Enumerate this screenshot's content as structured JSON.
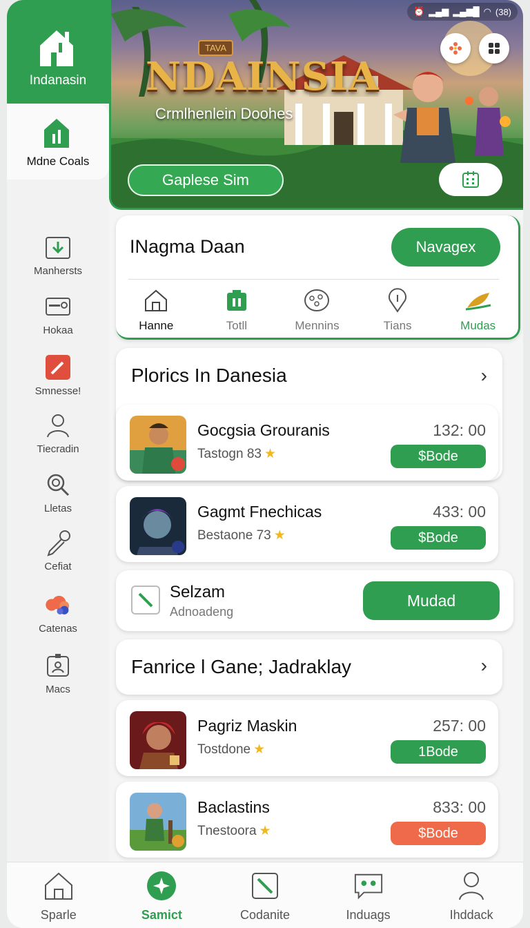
{
  "status": {
    "icons": [
      "alarm-icon",
      "signal-icon",
      "signal-icon",
      "wifi-icon",
      "battery-icon"
    ],
    "battery": "(38)"
  },
  "sidebar": {
    "top": {
      "label": "Indanasin",
      "icon": "home-icon"
    },
    "selected": {
      "label": "Mdne Coals",
      "icon": "home-icon"
    },
    "items": [
      {
        "label": "Manhersts",
        "icon": "download-icon"
      },
      {
        "label": "Hokaa",
        "icon": "card-icon"
      },
      {
        "label": "Smnesse!",
        "icon": "pencil-icon"
      },
      {
        "label": "Tiecradin",
        "icon": "person-icon"
      },
      {
        "label": "Lletas",
        "icon": "search-icon"
      },
      {
        "label": "Cefiat",
        "icon": "microphone-icon"
      },
      {
        "label": "Catenas",
        "icon": "clouds-icon"
      },
      {
        "label": "Macs",
        "icon": "badge-icon"
      }
    ]
  },
  "hero": {
    "logo_badge": "TAVA",
    "logo_title": "NDAINSIA",
    "subtitle": "Crmlhenlein Doohes",
    "cta": "Gaplese Sim"
  },
  "main_card": {
    "title": "INagma Daan",
    "button": "Navagex",
    "tabs": [
      {
        "label": "Hanne",
        "icon": "home-icon"
      },
      {
        "label": "Totll",
        "icon": "download-icon"
      },
      {
        "label": "Mennins",
        "icon": "palette-icon"
      },
      {
        "label": "Tians",
        "icon": "location-icon"
      },
      {
        "label": "Mudas",
        "icon": "leaf-icon"
      }
    ]
  },
  "section1": {
    "title": "Plorics In Danesia",
    "chevron": "›"
  },
  "games1": [
    {
      "name": "Gocgsia Grouranis",
      "sub": "Tastogn 83",
      "star": "★",
      "price": "132: 00",
      "pill": "$Bode"
    },
    {
      "name": "Gagmt Fnechicas",
      "sub": "Bestaone 73",
      "star": "★",
      "price": "433: 00",
      "pill": "$Bode"
    }
  ],
  "select_card": {
    "title": "Selzam",
    "subtitle": "Adnoadeng",
    "button": "Mudad"
  },
  "section2": {
    "title": "Fanrice l Gane; Jadraklay",
    "chevron": "›"
  },
  "games2": [
    {
      "name": "Pagriz Maskin",
      "sub": "Tostdone",
      "star": "★",
      "price": "257: 00",
      "pill": "1Bode"
    },
    {
      "name": "Baclastins",
      "sub": "Tnestoora",
      "star": "★",
      "price": "833: 00",
      "pill": "$Bode"
    }
  ],
  "bottom_nav": [
    {
      "label": "Sparle",
      "icon": "home-icon"
    },
    {
      "label": "Samict",
      "icon": "sparkle-icon"
    },
    {
      "label": "Codanite",
      "icon": "edit-icon"
    },
    {
      "label": "Induags",
      "icon": "chat-icon"
    },
    {
      "label": "Ihddack",
      "icon": "person-icon"
    }
  ],
  "colors": {
    "accent": "#2f9e50",
    "orange": "#ee6a4a",
    "star": "#f2b81d"
  }
}
